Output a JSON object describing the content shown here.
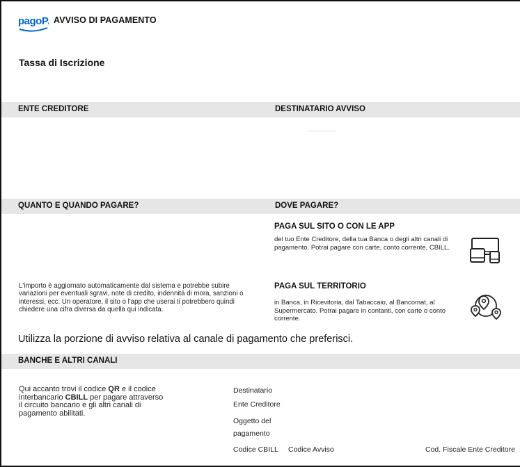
{
  "header": {
    "logo_text": "pagoPA",
    "title": "AVVISO DI PAGAMENTO",
    "subject": "Tassa di Iscrizione"
  },
  "sections": {
    "ente_creditore": "ENTE CREDITORE",
    "destinatario": "DESTINATARIO AVVISO",
    "quanto_quando": "QUANTO E QUANDO PAGARE?",
    "dove_pagare": "DOVE PAGARE?",
    "banche": "BANCHE E ALTRI CANALI"
  },
  "channels": {
    "app": {
      "title": "PAGA SUL SITO O CON LE APP",
      "description": "del tuo Ente Creditore, della tua Banca o degli altri canali di pagamento. Potrai pagare con carte, conto corrente, CBILL.",
      "icon": "devices-icon"
    },
    "territorio": {
      "title": "PAGA SUL TERRITORIO",
      "description": "in Banca, in Ricevitoria, dal Tabaccaio, al Bancomat, al Supermercato. Potrai pagare in contanti, con carte o conto corrente.",
      "icon": "map-pins-icon"
    }
  },
  "amount_note": "L'importo è aggiornato automaticamente dal sistema e potrebbe subire variazioni per eventuali sgravi, note di credito, indennità di mora, sanzioni o interessi, ecc. Un operatore, il sito o l'app che userai ti potrebbero quindi chiedere una cifra diversa da quella qui indicata.",
  "instruction": "Utilizza la porzione di avviso relativa al canale di pagamento che preferisci.",
  "bank_intro": {
    "part1": "Qui accanto trovi il codice ",
    "qr": "QR",
    "part2": " e il codice interbancario ",
    "cbill": "CBILL",
    "part3": " per pagare attraverso il circuito bancario e gli altri canali di pagamento abilitati."
  },
  "fields": {
    "destinatario": "Destinatario",
    "ente_creditore": "Ente Creditore",
    "oggetto_1": "Oggetto del",
    "oggetto_2": "pagamento",
    "codice_cbill": "Codice CBILL",
    "codice_avviso": "Codice Avviso",
    "cod_fiscale": "Cod. Fiscale Ente Creditore"
  },
  "colors": {
    "brand": "#0066cc",
    "band": "#e6e6e6"
  }
}
